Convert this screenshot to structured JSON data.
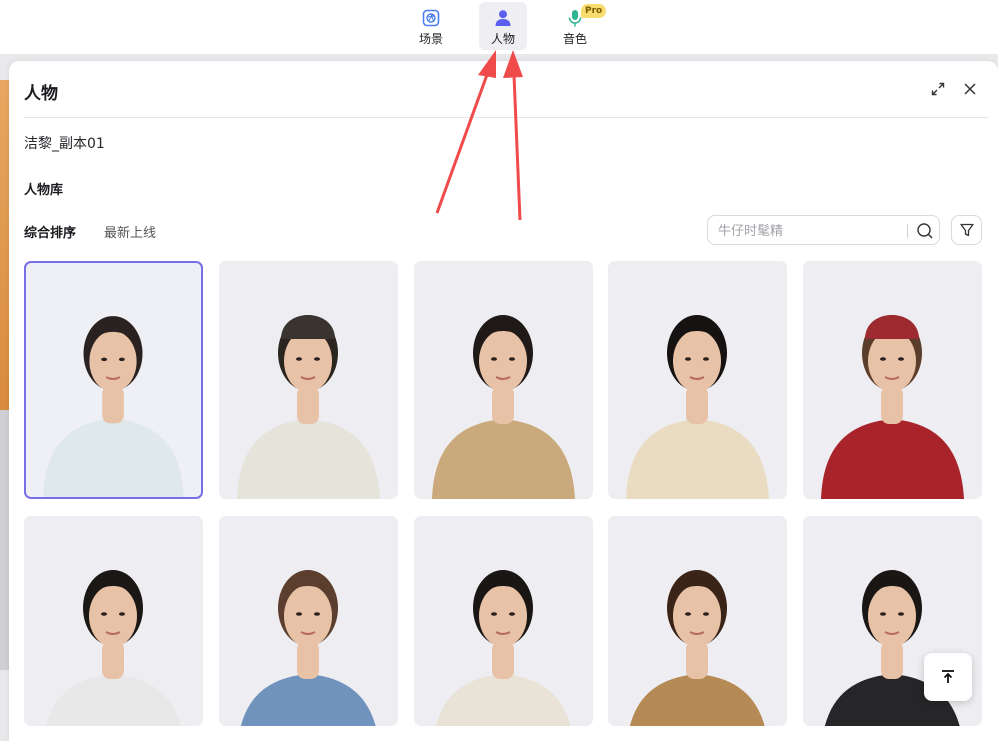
{
  "toolbar": {
    "items": [
      {
        "label": "场景",
        "icon": "scene-icon"
      },
      {
        "label": "人物",
        "icon": "person-icon",
        "active": true
      },
      {
        "label": "音色",
        "icon": "microphone-icon",
        "badge": "Pro"
      }
    ]
  },
  "panel": {
    "title": "人物",
    "current_name": "洁黎_副本01",
    "library_title": "人物库",
    "sort_tabs": [
      "综合排序",
      "最新上线"
    ],
    "search": {
      "placeholder": "牛仔时髦精"
    }
  },
  "colors": {
    "accent": "#7a6ee8",
    "arrow": "#ef4b4b",
    "pro_badge": "#f7dc6e"
  },
  "avatars": [
    {
      "outfit": "#dfe8ea",
      "hair": "#2a2220",
      "selected": true
    },
    {
      "outfit": "#e6e3da",
      "hair": "#2b2520",
      "hat": "#3a3430"
    },
    {
      "outfit": "#caa97c",
      "hair": "#1f1a18"
    },
    {
      "outfit": "#e9dcc2",
      "hair": "#161212"
    },
    {
      "outfit": "#a8232a",
      "hair": "#5a3d2a",
      "hat": "#9d2a2f"
    },
    {
      "outfit": "#e8e8e8",
      "hair": "#1b1715"
    },
    {
      "outfit": "#6f93bd",
      "hair": "#5b3e2e"
    },
    {
      "outfit": "#e8e3d6",
      "hair": "#1a1614"
    },
    {
      "outfit": "#b58a55",
      "hair": "#3a2418"
    },
    {
      "outfit": "#262628",
      "hair": "#1a1614"
    }
  ]
}
